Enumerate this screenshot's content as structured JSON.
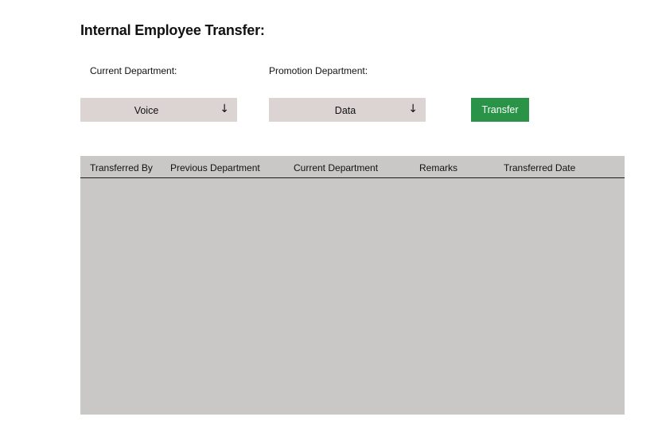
{
  "page": {
    "title": "Internal Employee Transfer:"
  },
  "form": {
    "current_department_label": "Current Department:",
    "promotion_department_label": "Promotion Department:",
    "current_department_value": "Voice",
    "promotion_department_value": "Data",
    "dropdown_icon": "arrow-down-icon",
    "transfer_button_label": "Transfer"
  },
  "table": {
    "columns": [
      "Transferred By",
      "Previous Department",
      "Current Department",
      "Remarks",
      "Transferred Date"
    ],
    "rows": []
  },
  "colors": {
    "select_bg": "#dcd3d3",
    "transfer_button_bg": "#299347",
    "table_bg": "#cac7c7"
  }
}
